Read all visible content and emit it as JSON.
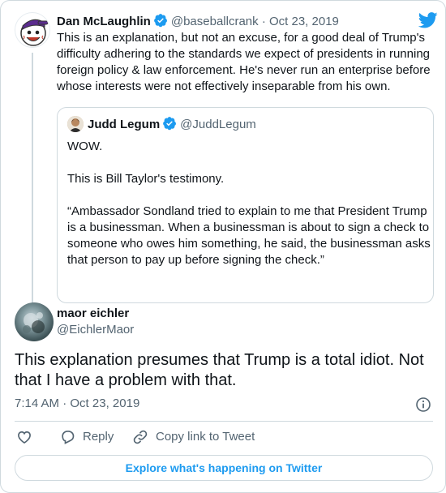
{
  "parent_tweet": {
    "author_name": "Dan McLaughlin",
    "handle": "@baseballcrank",
    "separator": "·",
    "date": "Oct 23, 2019",
    "text": "This is an explanation, but not an excuse, for a good deal of Trump's difficulty adhering to the standards we expect of presidents in running foreign policy & law enforcement. He's never run an enterprise before whose interests were not effectively inseparable from his own.",
    "verified": true
  },
  "quoted_tweet": {
    "author_name": "Judd Legum",
    "handle": "@JuddLegum",
    "verified": true,
    "paragraphs": [
      "WOW.",
      "This is Bill Taylor's testimony.",
      "“Ambassador Sondland tried to explain to me that President Trump is a businessman. When a businessman is about to sign a check to someone who owes him something, he said, the businessman asks that person to pay up before signing the check.”"
    ]
  },
  "main_tweet": {
    "author_name": "maor eichler",
    "handle": "@EichlerMaor",
    "text": "This explanation presumes that Trump is a total idiot. Not that I have a problem with that.",
    "time": "7:14 AM",
    "separator": "·",
    "date": "Oct 23, 2019"
  },
  "actions": {
    "reply_label": "Reply",
    "copy_link_label": "Copy link to Tweet"
  },
  "explore_label": "Explore what's happening on Twitter",
  "colors": {
    "accent": "#1d9bf0",
    "text": "#0f1419",
    "muted": "#536471",
    "border": "#cfd9de",
    "avatar_hat": "#5b2c8e"
  },
  "icons": [
    "twitter-bird-icon",
    "verified-badge-icon",
    "info-icon",
    "heart-icon",
    "reply-icon",
    "link-icon"
  ]
}
